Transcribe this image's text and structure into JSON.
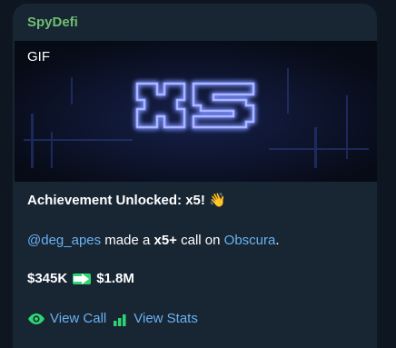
{
  "message": {
    "sender": "SpyDefi",
    "media": {
      "tag": "GIF",
      "caption_art": "x5",
      "glow_color": "#3d5bff"
    },
    "headline": "Achievement Unlocked: x5!",
    "headline_emoji": "👋",
    "call_line": {
      "mention": "@deg_apes",
      "text_before": " made a ",
      "multiplier": "x5+",
      "text_after": " call on ",
      "project": "Obscura",
      "end": "."
    },
    "price": {
      "from": "$345K",
      "to": "$1.8M",
      "arrow_icon": "right-arrow-icon",
      "arrow_color": "#2ed573"
    },
    "actions": [
      {
        "label": "View Call",
        "icon": "eye-icon"
      },
      {
        "label": "View Stats",
        "icon": "bar-chart-icon"
      }
    ]
  }
}
